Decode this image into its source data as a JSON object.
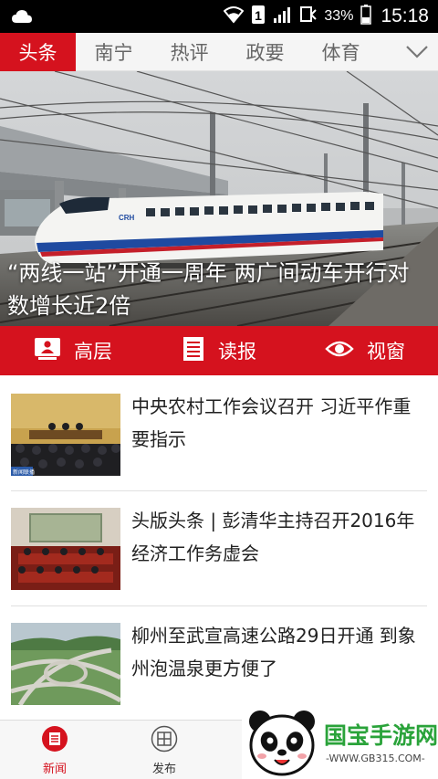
{
  "status_bar": {
    "battery_percent": "33%",
    "time": "15:18",
    "notification_icon": "cloud-icon",
    "icons": [
      "wifi-icon",
      "sim-1-icon",
      "signal-icon",
      "roaming-icon",
      "battery-icon"
    ]
  },
  "tabs": {
    "items": [
      {
        "label": "头条",
        "active": true
      },
      {
        "label": "南宁",
        "active": false
      },
      {
        "label": "热评",
        "active": false
      },
      {
        "label": "政要",
        "active": false
      },
      {
        "label": "体育",
        "active": false
      }
    ],
    "more_icon": "chevron-down-icon"
  },
  "hero": {
    "title": "“两线一站”开通一周年 两广间动车开行对数增长近2倍",
    "train_text": "CRH"
  },
  "quick_bar": {
    "items": [
      {
        "label": "高层",
        "icon": "podium-icon"
      },
      {
        "label": "读报",
        "icon": "newspaper-icon"
      },
      {
        "label": "视窗",
        "icon": "eye-icon"
      }
    ]
  },
  "news": [
    {
      "title": "中央农村工作会议召开 习近平作重要指示",
      "thumb_caption": "新闻联播"
    },
    {
      "title": "头版头条 | 彭清华主持召开2016年经济工作务虚会"
    },
    {
      "title": "柳州至武宣高速公路29日开通 到象州泡温泉更方便了"
    }
  ],
  "bottom_nav": {
    "items": [
      {
        "label": "新闻",
        "icon": "news-icon",
        "active": true
      },
      {
        "label": "发布",
        "icon": "grid-icon",
        "active": false
      }
    ]
  },
  "watermark": {
    "logo_text": "国宝手游网",
    "url": "-WWW.GB315.COM-"
  },
  "colors": {
    "accent": "#d5121e",
    "tab_text": "#666666",
    "watermark_green": "#2aa33a"
  }
}
